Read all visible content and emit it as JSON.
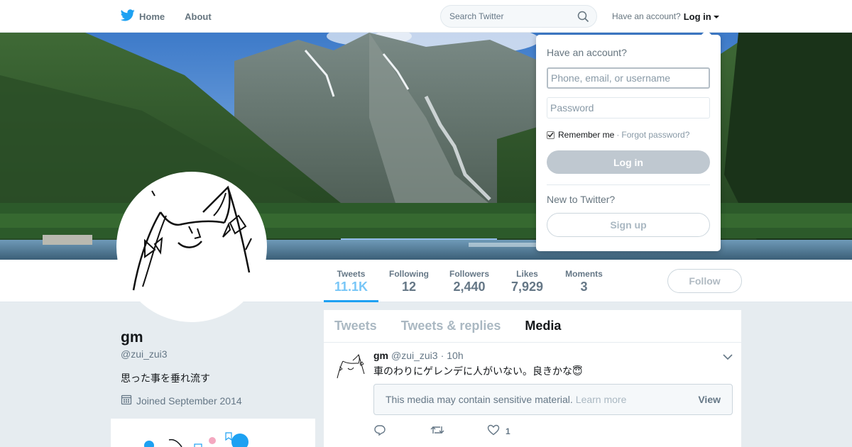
{
  "colors": {
    "brand": "#1da1f2",
    "background": "#e6ecf0",
    "text": "#14171a",
    "muted": "#657786"
  },
  "topbar": {
    "home_label": "Home",
    "about_label": "About",
    "search_placeholder": "Search Twitter",
    "account_prompt": "Have an account?",
    "login_label": "Log in"
  },
  "profile": {
    "name": "gm",
    "handle": "@zui_zui3",
    "bio": "思った事を垂れ流す",
    "joined": "Joined September 2014"
  },
  "stats": [
    {
      "label": "Tweets",
      "value": "11.1K"
    },
    {
      "label": "Following",
      "value": "12"
    },
    {
      "label": "Followers",
      "value": "2,440"
    },
    {
      "label": "Likes",
      "value": "7,929"
    },
    {
      "label": "Moments",
      "value": "3"
    }
  ],
  "follow_label": "Follow",
  "timeline": {
    "tabs": [
      "Tweets",
      "Tweets & replies",
      "Media"
    ],
    "active_tab": "Media",
    "tweet": {
      "name": "gm",
      "handle": "@zui_zui3",
      "separator": "·",
      "time": "10h",
      "text": "車のわりにゲレンデに人がいない。良きかな😇",
      "sensitive_text": "This media may contain sensitive material.",
      "learn_more": "Learn more",
      "view_label": "View",
      "likes": "1"
    }
  },
  "login_dropdown": {
    "title": "Have an account?",
    "username_placeholder": "Phone, email, or username",
    "password_placeholder": "Password",
    "remember_label": "Remember me",
    "separator": "·",
    "forgot_label": "Forgot password?",
    "login_button": "Log in",
    "new_prompt": "New to Twitter?",
    "signup_button": "Sign up"
  }
}
